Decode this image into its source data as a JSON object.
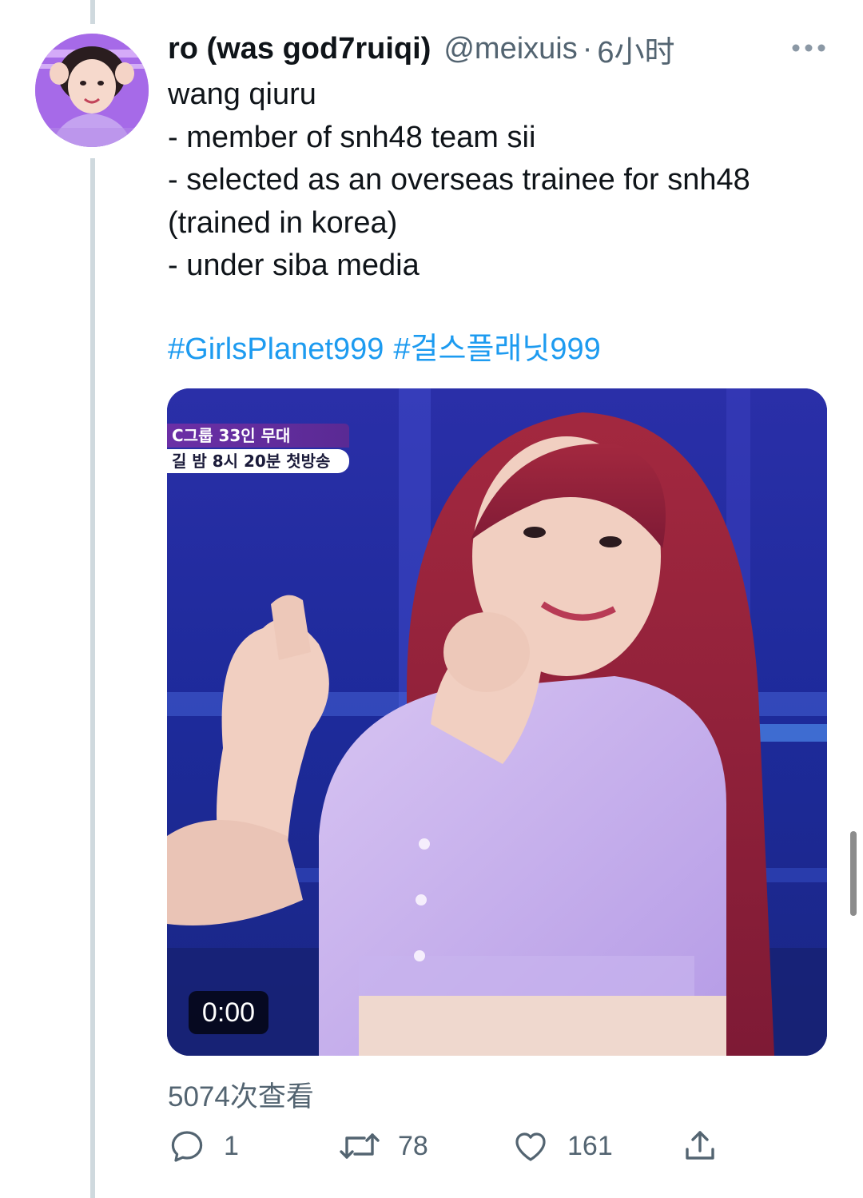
{
  "tweet": {
    "display_name": "ro (was god7ruiqi)",
    "handle": "@meixuis",
    "separator": "·",
    "time": "6小时",
    "lines": [
      "wang qiuru",
      "- member of snh48 team sii",
      "- selected as an overseas trainee for snh48",
      "(trained in korea)",
      "- under siba media"
    ],
    "hashtags": [
      "#GirlsPlanet999",
      "#걸스플래닛999"
    ]
  },
  "media": {
    "overlay_line1": "C그룹 33인 무대",
    "overlay_line2": "길 밤 8시 20분 첫방송",
    "video_time": "0:00"
  },
  "views": "5074次查看",
  "actions": {
    "reply_count": "1",
    "retweet_count": "78",
    "like_count": "161"
  },
  "icons": {
    "more": "more-horizontal-icon",
    "reply": "reply-icon",
    "retweet": "retweet-icon",
    "like": "heart-icon",
    "share": "share-icon"
  },
  "colors": {
    "text": "#0f1419",
    "secondary": "#536471",
    "link": "#1d9bf0",
    "thread_line": "#cfd9de"
  }
}
